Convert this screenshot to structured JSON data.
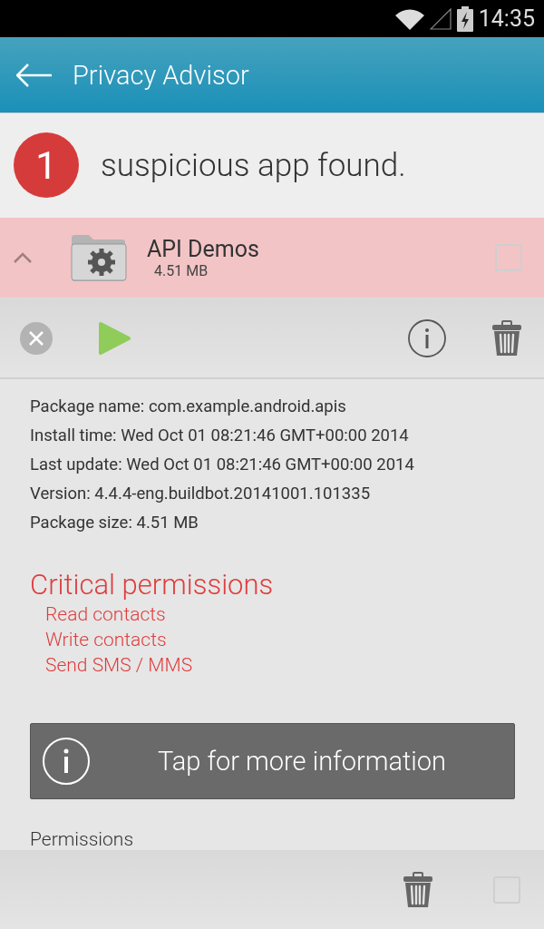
{
  "status_bar": {
    "time": "14:35"
  },
  "app_bar": {
    "title": "Privacy Advisor"
  },
  "summary": {
    "count": "1",
    "text": "suspicious app found."
  },
  "app": {
    "name": "API Demos",
    "size": "4.51 MB",
    "expanded": true,
    "checked": false
  },
  "details": [
    "Package name: com.example.android.apis",
    "Install time: Wed Oct 01 08:21:46 GMT+00:00 2014",
    "Last update: Wed Oct 01 08:21:46 GMT+00:00 2014",
    "Version: 4.4.4-eng.buildbot.20141001.101335",
    "Package size: 4.51 MB"
  ],
  "critical": {
    "title": "Critical permissions",
    "items": [
      "Read contacts",
      "Write contacts",
      "Send SMS / MMS"
    ]
  },
  "info_button": {
    "label": "Tap for more information"
  },
  "permissions": {
    "title": "Permissions"
  },
  "bottom_bar": {
    "checked": false
  }
}
